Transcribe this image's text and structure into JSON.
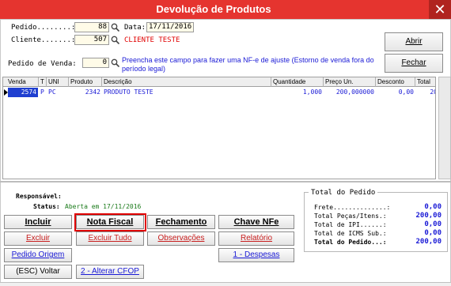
{
  "window": {
    "title": "Devolução de Produtos",
    "close_glyph": "✕"
  },
  "form": {
    "pedido_label": "Pedido........:",
    "pedido_value": "88",
    "data_label": "Data:",
    "data_value": "17/11/2016",
    "cliente_label": "Cliente.......:",
    "cliente_value": "507",
    "cliente_name": "CLIENTE TESTE",
    "pedido_venda_label": "Pedido de Venda:",
    "pedido_venda_value": "0",
    "hint": "Preencha este campo para fazer uma NF-e de ajuste (Estorno de venda fora do período legal)"
  },
  "side_buttons": {
    "abrir": "Abrir",
    "fechar": "Fechar"
  },
  "grid": {
    "columns": [
      "Venda",
      "T",
      "UNI",
      "Produto",
      "Descrição",
      "Quantidade",
      "Preço Un.",
      "Desconto",
      "Total"
    ],
    "rows": [
      {
        "venda": "2574",
        "t": "P",
        "uni": "PC",
        "produto": "2342",
        "descricao": "PRODUTO TESTE",
        "quantidade": "1,000",
        "preco": "200,000000",
        "desconto": "0,00",
        "total": "20"
      }
    ]
  },
  "info": {
    "responsavel_label": "Responsável:",
    "status_label": "Status:",
    "status_value": "Aberta em 17/11/2016"
  },
  "buttons": {
    "incluir": "Incluir",
    "nota_fiscal": "Nota Fiscal",
    "fechamento": "Fechamento",
    "chave_nfe": "Chave NFe",
    "excluir": "Excluir",
    "excluir_tudo": "Excluir Tudo",
    "observacoes": "Observações",
    "relatorio": "Relatório",
    "pedido_origem": "Pedido Origem",
    "despesas": "1 - Despesas",
    "voltar": "(ESC) Voltar",
    "alterar_cfop": "2 - Alterar CFOP"
  },
  "totals": {
    "title": "Total do Pedido",
    "frete_label": "Frete..............:",
    "frete_value": "0,00",
    "pecas_label": "Total Peças/Itens.:",
    "pecas_value": "200,00",
    "ipi_label": "Total de IPI......:",
    "ipi_value": "0,00",
    "icms_label": "Total de ICMS Sub.:",
    "icms_value": "0,00",
    "pedido_label": "Total do Pedido...:",
    "pedido_value": "200,00"
  },
  "colors": {
    "titlebar": "#e5342f",
    "highlight": "#e00000",
    "link_blue": "#1a1ad6",
    "selection": "#1f3fd0"
  },
  "icons": {
    "search": "magnifier-icon",
    "close": "close-icon",
    "row_pointer": "triangle-right-icon"
  }
}
